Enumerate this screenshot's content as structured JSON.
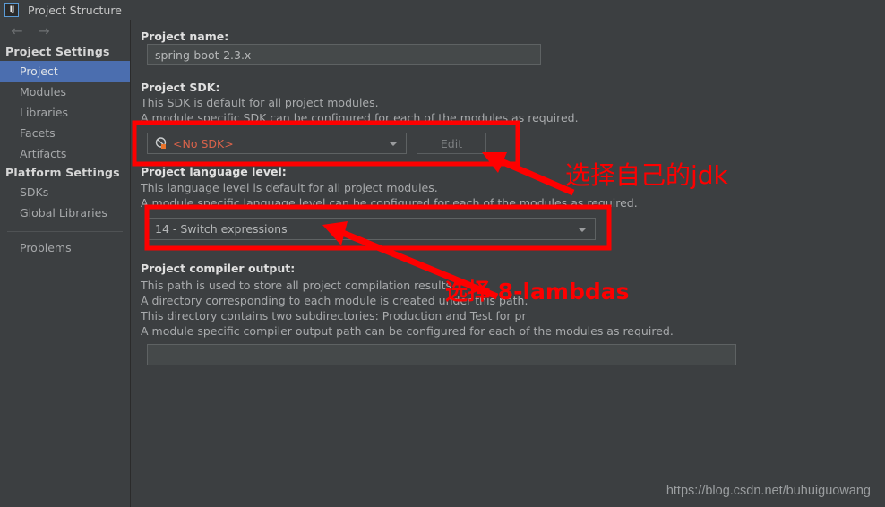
{
  "window": {
    "title": "Project Structure",
    "app_icon": "intellij-idea-icon",
    "icon_text": "IJ"
  },
  "nav": {
    "back_icon": "arrow-left-icon",
    "back_glyph": "←",
    "forward_icon": "arrow-right-icon",
    "forward_glyph": "→"
  },
  "sidebar": {
    "groups": [
      {
        "header": "Project Settings",
        "items": [
          {
            "label": "Project",
            "selected": true
          },
          {
            "label": "Modules",
            "selected": false
          },
          {
            "label": "Libraries",
            "selected": false
          },
          {
            "label": "Facets",
            "selected": false
          },
          {
            "label": "Artifacts",
            "selected": false
          }
        ]
      },
      {
        "header": "Platform Settings",
        "items": [
          {
            "label": "SDKs",
            "selected": false
          },
          {
            "label": "Global Libraries",
            "selected": false
          }
        ]
      }
    ],
    "footer_items": [
      {
        "label": "Problems",
        "selected": false
      }
    ]
  },
  "main": {
    "project_name": {
      "label": "Project name:",
      "value": "spring-boot-2.3.x",
      "placeholder": ""
    },
    "project_sdk": {
      "label": "Project SDK:",
      "desc_line1": "This SDK is default for all project modules.",
      "desc_line2": "A module specific SDK can be configured for each of the modules as required.",
      "selected": "<No SDK>",
      "sdk_icon": "no-sdk-icon",
      "edit_button": "Edit"
    },
    "language_level": {
      "label": "Project language level:",
      "desc_line1": "This language level is default for all project modules.",
      "desc_line2": "A module specific language level can be configured for each of the modules as required.",
      "selected": "14 - Switch expressions"
    },
    "compiler_output": {
      "label": "Project compiler output:",
      "desc_line1": "This path is used to store all project compilation results.",
      "desc_line2": "A directory corresponding to each module is created under this path.",
      "desc_line3": "This directory contains two subdirectories: Production and Test for pr",
      "desc_line4": "A module specific compiler output path can be configured for each of the modules as required.",
      "value": "",
      "browse_icon": "folder-browse-icon"
    }
  },
  "annotations": {
    "note_sdk": "选择自己的jdk",
    "note_language_level": "选择 8-lambdas",
    "highlight_color": "#fe0000"
  },
  "watermark": {
    "text": "https://blog.csdn.net/buhuiguowang"
  },
  "colors": {
    "background": "#3c3f41",
    "selection": "#4b6eaf",
    "field_background": "#45494a",
    "border": "#5e6263",
    "text": "#a9abad",
    "heading": "#e0e0e0",
    "sdk_warning": "#d9624a",
    "annotation": "#fe0000"
  }
}
